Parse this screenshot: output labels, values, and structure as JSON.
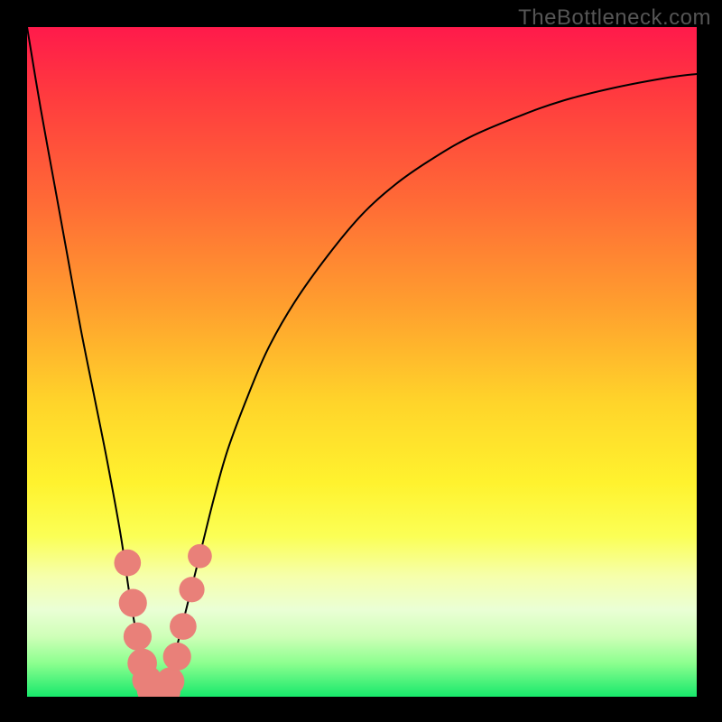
{
  "watermark": "TheBottleneck.com",
  "chart_data": {
    "type": "line",
    "title": "",
    "xlabel": "",
    "ylabel": "",
    "xlim": [
      0,
      100
    ],
    "ylim": [
      0,
      100
    ],
    "legend": false,
    "grid": false,
    "series": [
      {
        "name": "curve",
        "x": [
          0,
          2,
          4,
          6,
          8,
          10,
          12,
          14,
          15.5,
          17,
          18,
          19,
          20,
          21,
          22,
          24,
          26,
          28,
          30,
          33,
          36,
          40,
          45,
          50,
          55,
          60,
          66,
          73,
          80,
          88,
          96,
          100
        ],
        "y": [
          100,
          88,
          77,
          66,
          55,
          45,
          35,
          24,
          14,
          6,
          2,
          0,
          0,
          2,
          6,
          14,
          22,
          30,
          37,
          45,
          52,
          59,
          66,
          72,
          76.5,
          80,
          83.5,
          86.5,
          89,
          91,
          92.5,
          93
        ]
      }
    ],
    "markers": {
      "name": "highlight-points",
      "color": "#e98079",
      "points": [
        {
          "x": 15.0,
          "y": 20.0,
          "r": 2.0
        },
        {
          "x": 15.8,
          "y": 14.0,
          "r": 2.1
        },
        {
          "x": 16.5,
          "y": 9.0,
          "r": 2.1
        },
        {
          "x": 17.2,
          "y": 5.0,
          "r": 2.2
        },
        {
          "x": 17.9,
          "y": 2.5,
          "r": 2.2
        },
        {
          "x": 18.6,
          "y": 1.0,
          "r": 2.2
        },
        {
          "x": 19.3,
          "y": 0.3,
          "r": 2.2
        },
        {
          "x": 20.0,
          "y": 0.2,
          "r": 2.2
        },
        {
          "x": 20.7,
          "y": 0.8,
          "r": 2.2
        },
        {
          "x": 21.4,
          "y": 2.3,
          "r": 2.1
        },
        {
          "x": 22.4,
          "y": 6.0,
          "r": 2.1
        },
        {
          "x": 23.3,
          "y": 10.5,
          "r": 2.0
        },
        {
          "x": 24.6,
          "y": 16.0,
          "r": 1.9
        },
        {
          "x": 25.8,
          "y": 21.0,
          "r": 1.8
        }
      ]
    },
    "background_gradient": [
      {
        "pos": 0.0,
        "color": "#ff1a4b"
      },
      {
        "pos": 0.1,
        "color": "#ff3a3f"
      },
      {
        "pos": 0.26,
        "color": "#ff6a36"
      },
      {
        "pos": 0.42,
        "color": "#ffa02e"
      },
      {
        "pos": 0.56,
        "color": "#ffd42a"
      },
      {
        "pos": 0.68,
        "color": "#fff22e"
      },
      {
        "pos": 0.76,
        "color": "#fbff55"
      },
      {
        "pos": 0.82,
        "color": "#f6ffab"
      },
      {
        "pos": 0.87,
        "color": "#eaffd5"
      },
      {
        "pos": 0.91,
        "color": "#cfffb8"
      },
      {
        "pos": 0.95,
        "color": "#8cff8f"
      },
      {
        "pos": 1.0,
        "color": "#17e86b"
      }
    ]
  }
}
